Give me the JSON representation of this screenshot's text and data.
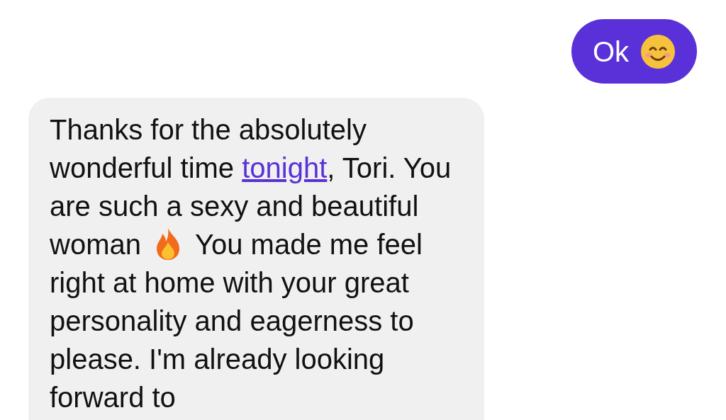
{
  "messages": [
    {
      "kind": "sent",
      "parts": [
        {
          "kind": "text",
          "text": "Ok"
        },
        {
          "kind": "smile"
        }
      ]
    },
    {
      "kind": "received",
      "parts": [
        {
          "kind": "text",
          "text": "Thanks for the absolutely wonderful time "
        },
        {
          "kind": "link",
          "text": "tonight"
        },
        {
          "kind": "text",
          "text": ", Tori. You are such a sexy and beautiful woman"
        },
        {
          "kind": "flame"
        },
        {
          "kind": "text",
          "text": "You made me feel right at home with your great personality and eagerness to please. I'm already looking forward to"
        }
      ]
    }
  ]
}
